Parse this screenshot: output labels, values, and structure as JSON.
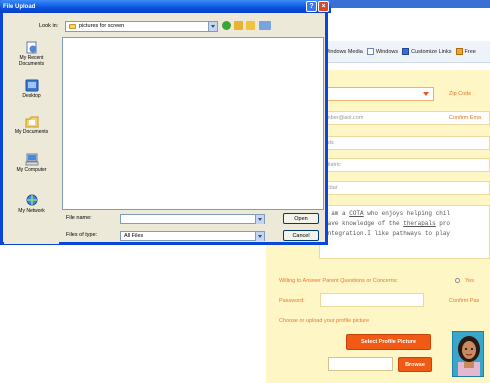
{
  "dialog": {
    "title": "File Upload",
    "help_glyph": "?",
    "close_glyph": "×",
    "look_in_label": "Look in:",
    "look_in_value": "pictures for screen",
    "places": [
      {
        "label_line1": "My Recent",
        "label_line2": "Documents",
        "icon": "recent-documents-icon"
      },
      {
        "label_line1": "Desktop",
        "label_line2": "",
        "icon": "desktop-icon"
      },
      {
        "label_line1": "My Documents",
        "label_line2": "",
        "icon": "my-documents-icon"
      },
      {
        "label_line1": "My Computer",
        "label_line2": "",
        "icon": "my-computer-icon"
      },
      {
        "label_line1": "My Network",
        "label_line2": "",
        "icon": "my-network-icon"
      }
    ],
    "file_name_label": "File name:",
    "file_name_value": "",
    "file_type_label": "Files of type:",
    "file_type_value": "All Files",
    "open_button": "Open",
    "cancel_button": "Cancel"
  },
  "browser": {
    "bookmarks": [
      "Windows Media",
      "Windows",
      "Customize Links",
      "Free"
    ]
  },
  "form": {
    "zip_label": "Zip Code",
    "email_value": "ember@aol.com",
    "confirm_email_label": "Confirm Ema",
    "field_1_value": "Kids",
    "field_2_value": "ediatric",
    "field_3_value": "incitar",
    "bio_line1_a": "I am a ",
    "bio_line1_b": "COTA",
    "bio_line1_c": " who enjoys helping chil",
    "bio_line2_a": "have knowledge of the ",
    "bio_line2_b": "therapals",
    "bio_line2_c": " pro",
    "bio_line3": "integration.I like pathways to play",
    "willing_label": "Willing to Answer Parent Questions or Concerns:",
    "yes_label": "Yes",
    "password_label": "Password:",
    "confirm_password_label": "Confirm Pas",
    "upload_prompt": "Choose or upload your profile picture",
    "select_picture_button": "Select Profile Picture",
    "browse_button": "Browse"
  },
  "colors": {
    "titlebar": "#0753e0",
    "form_background": "#fff6c6",
    "accent_orange": "#f15a14",
    "label_orange": "#e3782a"
  }
}
